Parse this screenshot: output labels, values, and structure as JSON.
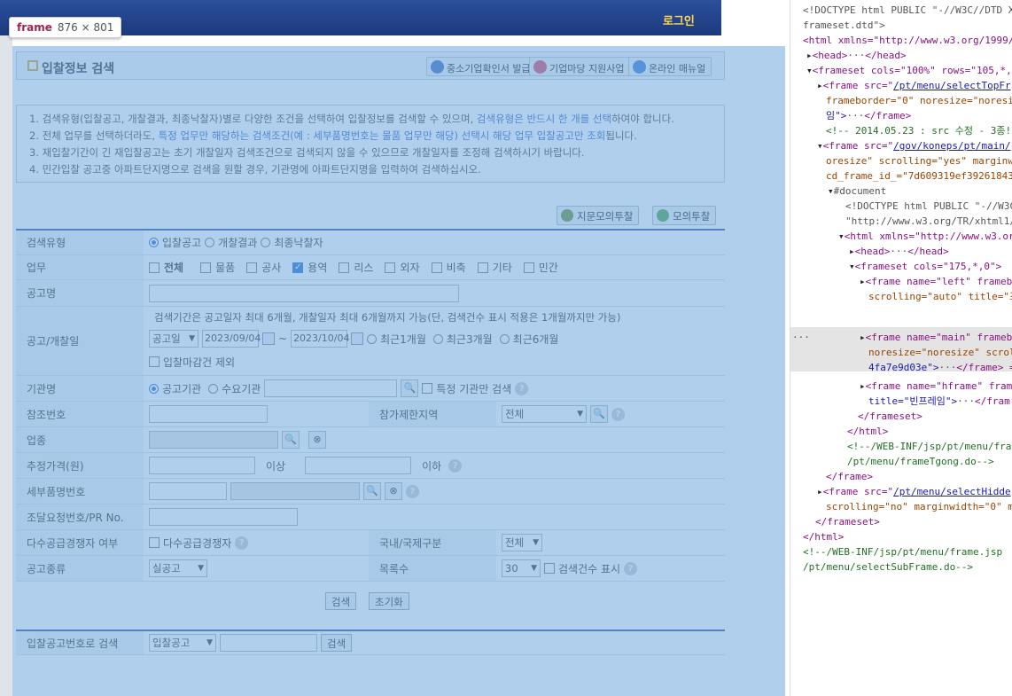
{
  "topbar": {
    "login": "로그인"
  },
  "tooltip": {
    "name": "frame",
    "dims": "876 × 801"
  },
  "title": {
    "text": "입찰정보 검색",
    "btn1": "중소기업확인서 발급",
    "btn2": "기업마당 지원사업",
    "btn3": "온라인 매뉴얼"
  },
  "info": {
    "l1a": "1. 검색유형(입찰공고, 개찰결과, 최종낙찰자)별로 다양한 조건을 선택하여 입찰정보를 검색할 수 있으며, ",
    "l1b": "검색유형은 반드시 한 개를 선택",
    "l1c": "하여야 합니다.",
    "l2a": "2. 전체 업무를 선택하더라도, ",
    "l2b": "특정 업무만 해당하는 검색조건(예 : 세부품명번호는 물품 업무만 해당) 선택시 해당 업무 입찰공고만 조회",
    "l2c": "됩니다.",
    "l3": "3. 재입찰기간이 긴 재입찰공고는 초기 개찰일자 검색조건으로 검색되지 않을 수 있으므로 개찰일자를 조정해 검색하시기 바랍니다.",
    "l4": "4. 민간입찰 공고중 아파트단지명으로 검색을 원할 경우, 기관명에 아파트단지명을 입력하여 검색하십시오."
  },
  "mock": {
    "finger": "지문모의투찰",
    "mock": "모의투찰"
  },
  "form": {
    "search_type": {
      "label": "검색유형",
      "opts": [
        "입찰공고",
        "개찰결과",
        "최종낙찰자"
      ]
    },
    "work": {
      "label": "업무",
      "opts": [
        "전체",
        "물품",
        "공사",
        "용역",
        "리스",
        "외자",
        "비축",
        "기타",
        "민간"
      ]
    },
    "notice_name": {
      "label": "공고명"
    },
    "date": {
      "label": "공고/개찰일",
      "note": "검색기간은 공고일자 최대 6개월, 개찰일자 최대 6개월까지 가능(단, 검색건수 표시 적용은 1개월까지만 가능)",
      "sel": "공고일",
      "from": "2023/09/04",
      "tilde": "~",
      "to": "2023/10/04",
      "r1": "최근1개월",
      "r2": "최근3개월",
      "r3": "최근6개월",
      "excl": "입찰마감건 제외"
    },
    "org": {
      "label": "기관명",
      "o1": "공고기관",
      "o2": "수요기관",
      "only": "특정 기관만 검색"
    },
    "ref": {
      "label": "참조번호",
      "label2": "참가제한지역",
      "sel": "전체"
    },
    "industry": {
      "label": "업종"
    },
    "price": {
      "label": "추정가격(원)",
      "above": "이상",
      "below": "이하"
    },
    "detail": {
      "label": "세부품명번호"
    },
    "pr": {
      "label": "조달요청번호/PR No."
    },
    "multi": {
      "label": "다수공급경쟁자 여부",
      "chk": "다수공급경쟁자",
      "label2": "국내/국제구분",
      "sel": "전체"
    },
    "kind": {
      "label": "공고종류",
      "sel": "실공고",
      "label2": "목록수",
      "sel2": "30",
      "count": "검색건수 표시"
    }
  },
  "actions": {
    "search": "검색",
    "reset": "초기화"
  },
  "bynum": {
    "label": "입찰공고번호로 검색",
    "sel": "입찰공고",
    "btn": "검색"
  },
  "dev": {
    "l1": "<!DOCTYPE html PUBLIC \"-//W3C//DTD X",
    "l2": "frameset.dtd\">",
    "l3a": "<html xmlns=\"http://www.w3.org/1999/",
    "l4": "<head>",
    "l4b": "</head>",
    "l5a": "<frameset cols=\"100%\" rows=\"105,*,",
    "l6a": "<frame src=\"",
    "l6b": "/pt/menu/selectTopFr",
    "l7": "frameborder=\"0\" noresize=\"noresi",
    "l8": "임\">",
    "l8b": "</frame>",
    "l9": "<!-- 2014.05.23 : src 수정 - 3종!",
    "l10a": "<frame src=\"",
    "l10b": "/gov/koneps/pt/main/",
    "l11": "oresize\" scrolling=\"yes\" marginw",
    "l12": "cd_frame_id_=\"7d609319ef39261843",
    "l13": "#document",
    "l14": "<!DOCTYPE html PUBLIC \"-//W3C",
    "l15": "\"http://www.w3.org/TR/xhtml1/",
    "l16": "<html xmlns=\"http://www.w3.or",
    "l17": "<head>",
    "l17b": "</head>",
    "l18": "<frameset cols=\"175,*,0\">",
    "l19": "<frame name=\"left\" frameb",
    "l20": "scrolling=\"auto\" title=\"조",
    "l21": "<frame name=\"main\" frameb",
    "l22": "noresize=\"noresize\" scrol",
    "l23": "4fa7e9d03e\">",
    "l23b": "</frame> =",
    "l24": "<frame name=\"hframe\" fram",
    "l25": "title=\"빈프레임\">",
    "l25b": "</fram",
    "l26": "</frameset>",
    "l27": "</html>",
    "l28": "<!--/WEB-INF/jsp/pt/menu/fram",
    "l29": "/pt/menu/frameTgong.do-->",
    "l30": "</frame>",
    "l31a": "<frame src=\"",
    "l31b": "/pt/menu/selectHidde",
    "l32": "scrolling=\"no\" marginwidth=\"0\" m",
    "l33": "</frameset>",
    "l34": "</html>",
    "l35": "<!--/WEB-INF/jsp/pt/menu/frame.jsp",
    "l36": "/pt/menu/selectSubFrame.do-->",
    "ellipsis": "···"
  }
}
